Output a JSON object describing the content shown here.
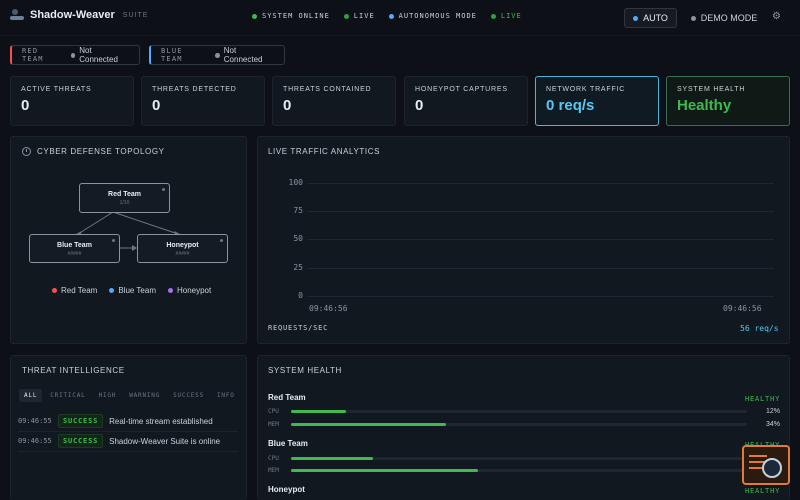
{
  "header": {
    "brand_name": "Shadow-Weaver",
    "brand_suite": "SUITE",
    "statuses": [
      {
        "label": "SYSTEM ONLINE"
      },
      {
        "label": "LIVE"
      },
      {
        "label": "AUTONOMOUS MODE"
      },
      {
        "label": "LIVE"
      }
    ],
    "auto_label": "AUTO",
    "demo_label": "DEMO MODE",
    "settings_icon": "gear-icon"
  },
  "connections": [
    {
      "team": "RED TEAM",
      "state": "Not Connected"
    },
    {
      "team": "BLUE TEAM",
      "state": "Not Connected"
    }
  ],
  "stats": [
    {
      "label": "ACTIVE THREATS",
      "value": "0"
    },
    {
      "label": "THREATS DETECTED",
      "value": "0"
    },
    {
      "label": "THREATS CONTAINED",
      "value": "0"
    },
    {
      "label": "HONEYPOT CAPTURES",
      "value": "0"
    },
    {
      "label": "NETWORK TRAFFIC",
      "value": "0 req/s"
    },
    {
      "label": "SYSTEM HEALTH",
      "value": "Healthy"
    }
  ],
  "topology": {
    "title": "CYBER DEFENSE TOPOLOGY",
    "nodes": [
      {
        "name": "Red Team",
        "sub": "1/10"
      },
      {
        "name": "Blue Team",
        "sub": "#####"
      },
      {
        "name": "Honeypot",
        "sub": "#####"
      }
    ],
    "legend": [
      "Red Team",
      "Blue Team",
      "Honeypot"
    ]
  },
  "traffic": {
    "title": "LIVE TRAFFIC ANALYTICS",
    "yticks": [
      "100",
      "75",
      "50",
      "25",
      "0"
    ],
    "xticks": [
      "09:46:56",
      "09:46:56"
    ],
    "requests_label": "REQUESTS/SEC",
    "requests_value": "56 req/s"
  },
  "intel": {
    "title": "THREAT INTELLIGENCE",
    "filters": [
      "ALL",
      "CRITICAL",
      "HIGH",
      "WARNING",
      "SUCCESS",
      "INFO"
    ],
    "logs": [
      {
        "time": "09:46:55",
        "level": "SUCCESS",
        "message": "Real-time stream established"
      },
      {
        "time": "09:46:55",
        "level": "SUCCESS",
        "message": "Shadow-Weaver Suite is online"
      }
    ]
  },
  "health": {
    "title": "SYSTEM HEALTH",
    "systems": [
      {
        "name": "Red Team",
        "status": "HEALTHY",
        "cpu_label": "CPU",
        "cpu": 12,
        "cpu_text": "12%",
        "mem_label": "MEM",
        "mem": 34,
        "mem_text": "34%"
      },
      {
        "name": "Blue Team",
        "status": "HEALTHY",
        "cpu_label": "CPU",
        "cpu": 18,
        "mem_label": "MEM",
        "mem": 41
      },
      {
        "name": "Honeypot",
        "status": "HEALTHY"
      }
    ]
  },
  "colors": {
    "accent_cyan": "#58c7f2",
    "healthy_green": "#3fb950",
    "red_team": "#f85149",
    "blue_team": "#58a6ff",
    "honeypot": "#a371f7"
  }
}
